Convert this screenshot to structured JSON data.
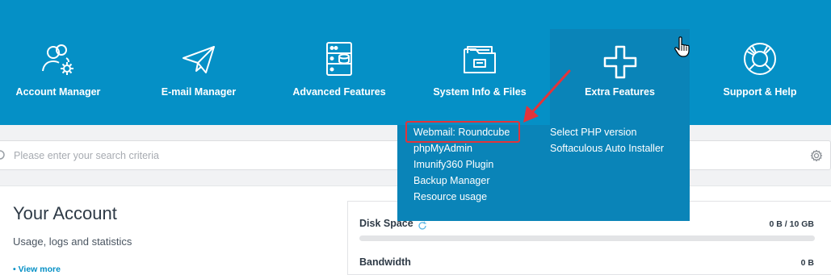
{
  "nav": {
    "items": [
      {
        "label": "Account Manager"
      },
      {
        "label": "E-mail Manager"
      },
      {
        "label": "Advanced Features"
      },
      {
        "label": "System Info & Files"
      },
      {
        "label": "Extra Features"
      },
      {
        "label": "Support & Help"
      }
    ]
  },
  "dropdown": {
    "left": [
      {
        "label": "Webmail: Roundcube"
      },
      {
        "label": "phpMyAdmin"
      },
      {
        "label": "Imunify360 Plugin"
      },
      {
        "label": "Backup Manager"
      },
      {
        "label": "Resource usage"
      }
    ],
    "right": [
      {
        "label": "Select PHP version"
      },
      {
        "label": "Softaculous Auto Installer"
      }
    ]
  },
  "search": {
    "placeholder": "Please enter your search criteria"
  },
  "account": {
    "title": "Your Account",
    "subtitle": "Usage, logs and statistics",
    "view_more": "• View more"
  },
  "stats": {
    "disk": {
      "label": "Disk Space",
      "value": "0 B / 10 GB",
      "fraction": 0.0
    },
    "bandwidth": {
      "label": "Bandwidth",
      "value": "0 B"
    }
  },
  "colors": {
    "nav_bg": "#0590c6",
    "nav_active": "#0a84b8",
    "highlight": "#e3343a"
  }
}
